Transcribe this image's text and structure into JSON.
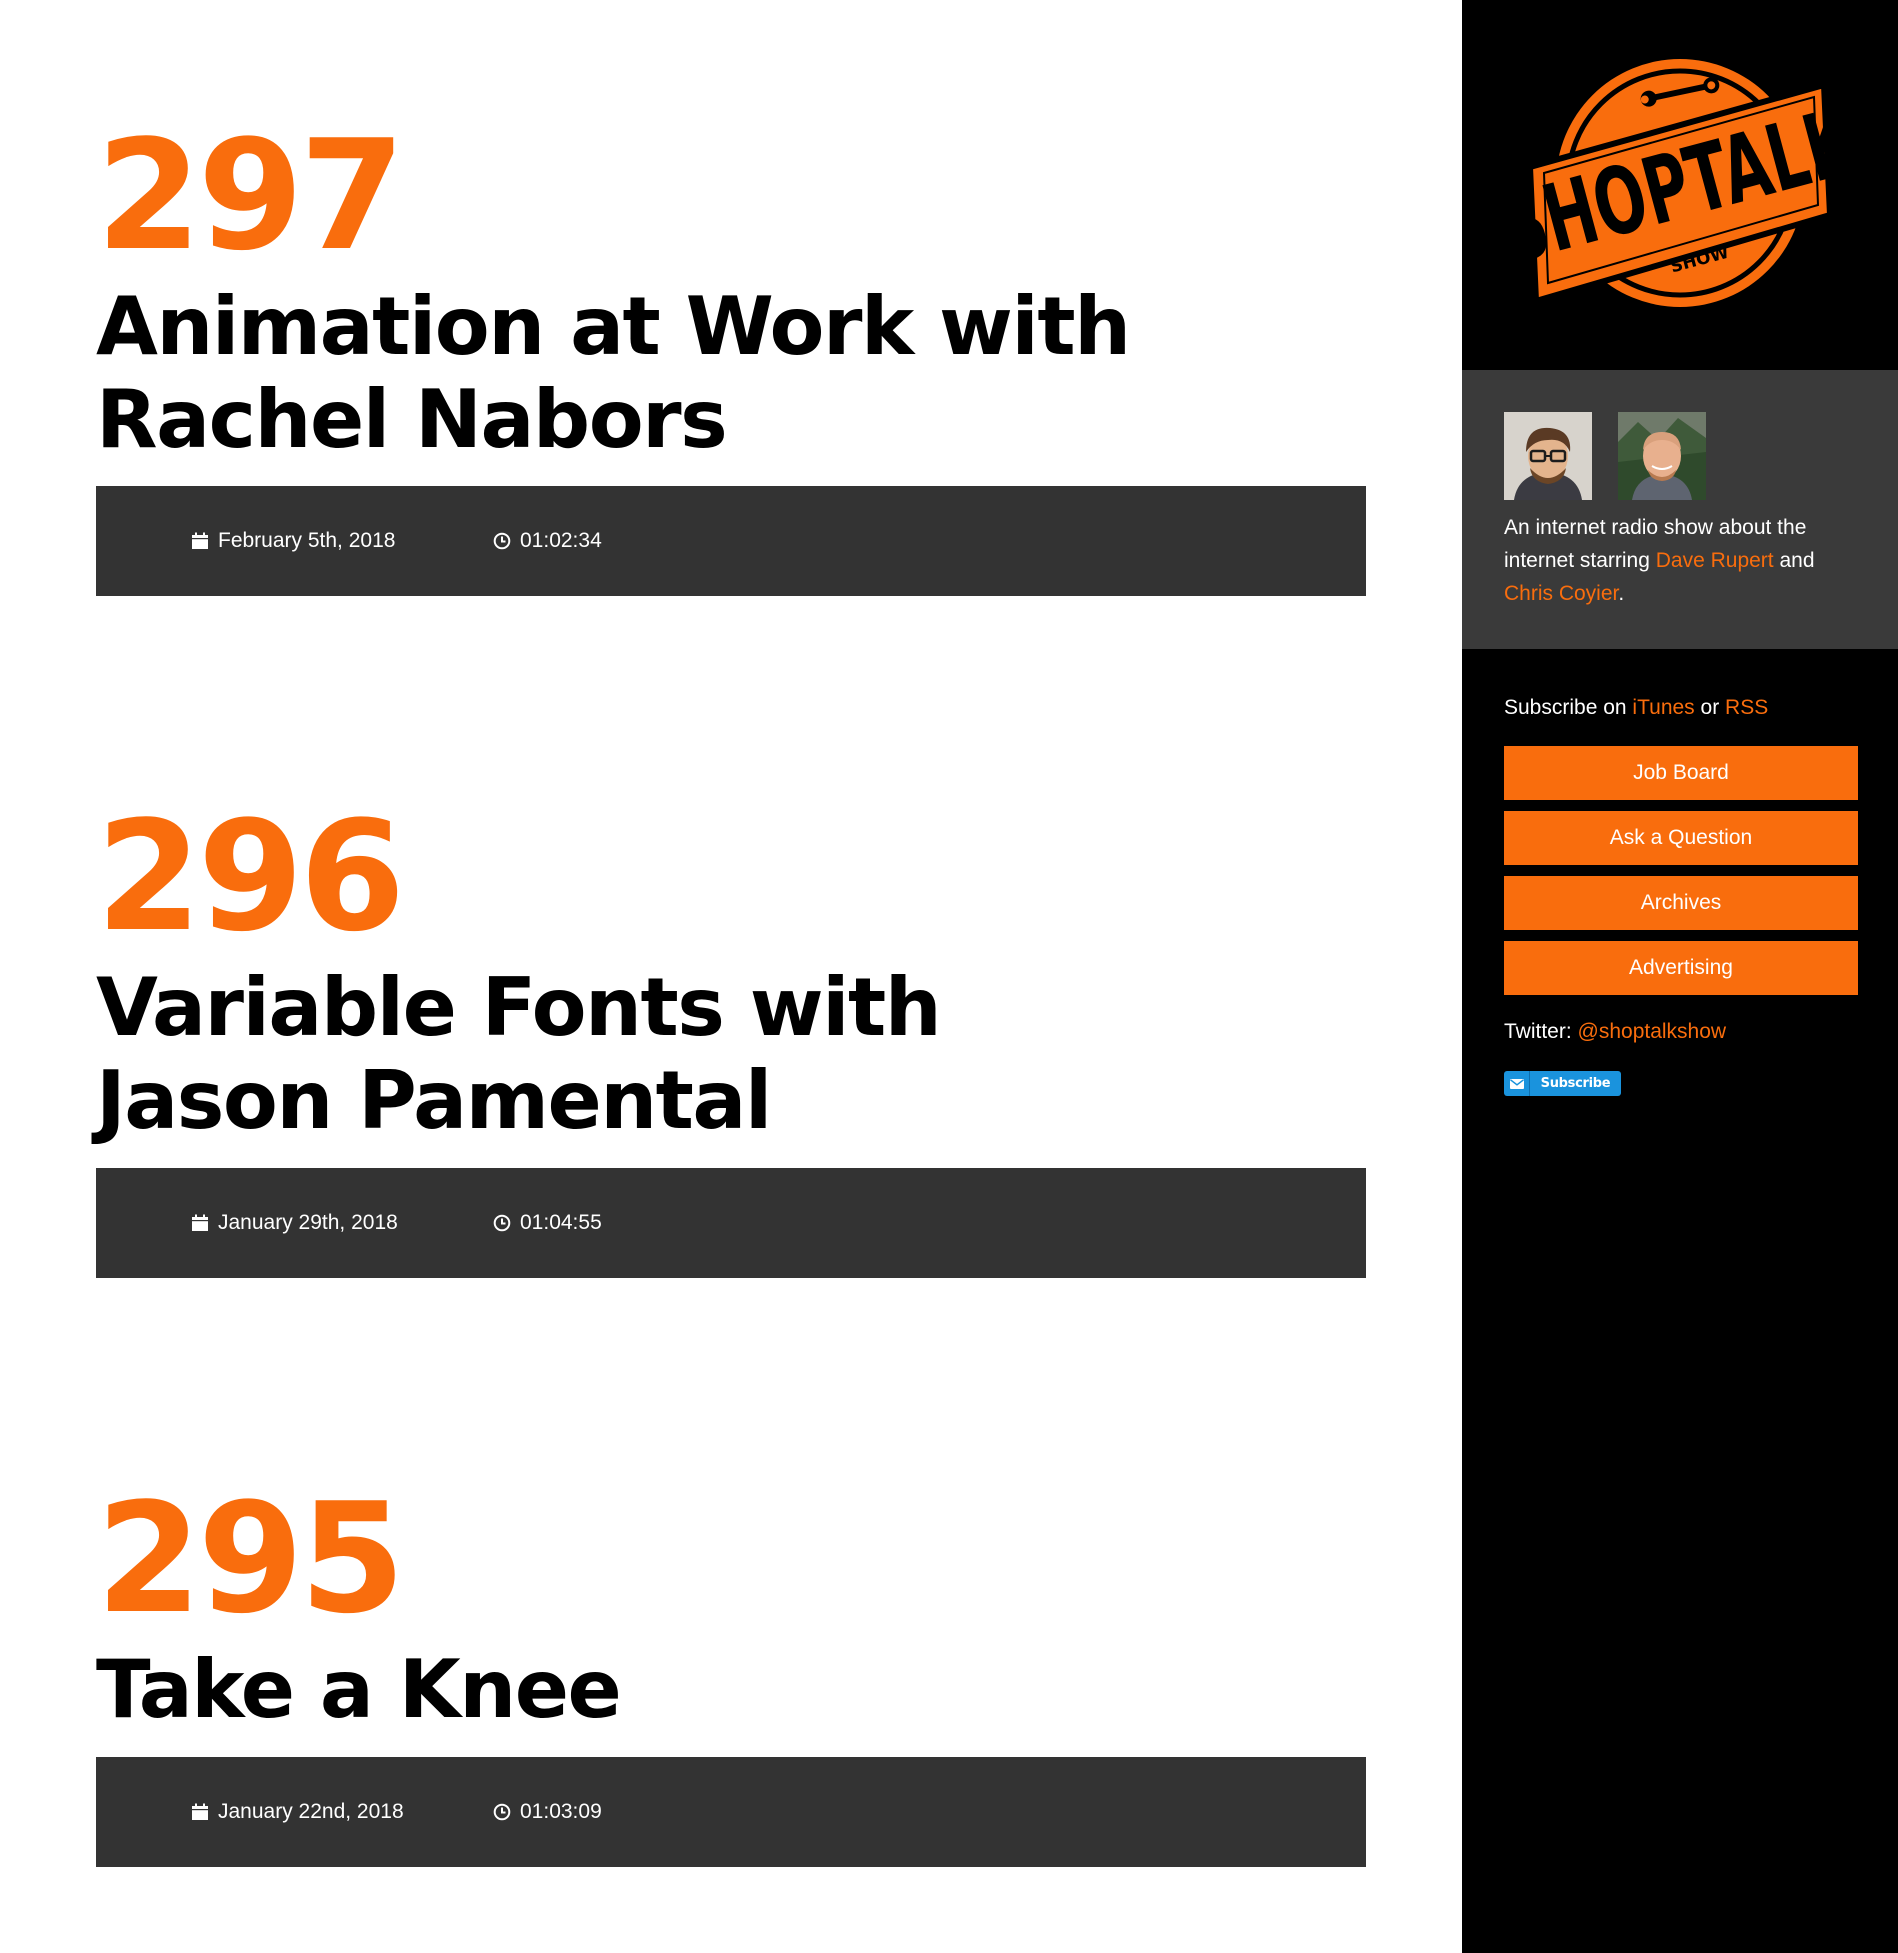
{
  "episodes": [
    {
      "number": "297",
      "title": "Animation at Work with Rachel Nabors",
      "date": "February 5th, 2018",
      "duration": "01:02:34"
    },
    {
      "number": "296",
      "title": "Variable Fonts with Jason Pamental",
      "date": "January 29th, 2018",
      "duration": "01:04:55"
    },
    {
      "number": "295",
      "title": "Take a Knee",
      "date": "January 22nd, 2018",
      "duration": "01:03:09"
    }
  ],
  "sidebar": {
    "logo": {
      "main_text": "SHOPTALK",
      "sub_text": "SHOW"
    },
    "about": {
      "text_before": "An internet radio show about the internet starring ",
      "host1": "Dave Rupert",
      "text_middle": " and ",
      "host2": "Chris Coyier",
      "text_after": "."
    },
    "subscribe": {
      "prefix": "Subscribe on ",
      "itunes": "iTunes",
      "or": " or ",
      "rss": "RSS"
    },
    "nav_buttons": [
      "Job Board",
      "Ask a Question",
      "Archives",
      "Advertising"
    ],
    "twitter": {
      "label": "Twitter: ",
      "handle": "@shoptalkshow"
    },
    "subscribe_badge": "Subscribe"
  },
  "colors": {
    "accent": "#f96d0d",
    "meta_bar": "#333333",
    "sidebar_bg": "#000000",
    "about_bg": "#3a3a3a",
    "badge_blue": "#1a93dd"
  },
  "icons": {
    "date": "calendar-icon",
    "duration": "clock-icon",
    "badge": "envelope-icon"
  }
}
